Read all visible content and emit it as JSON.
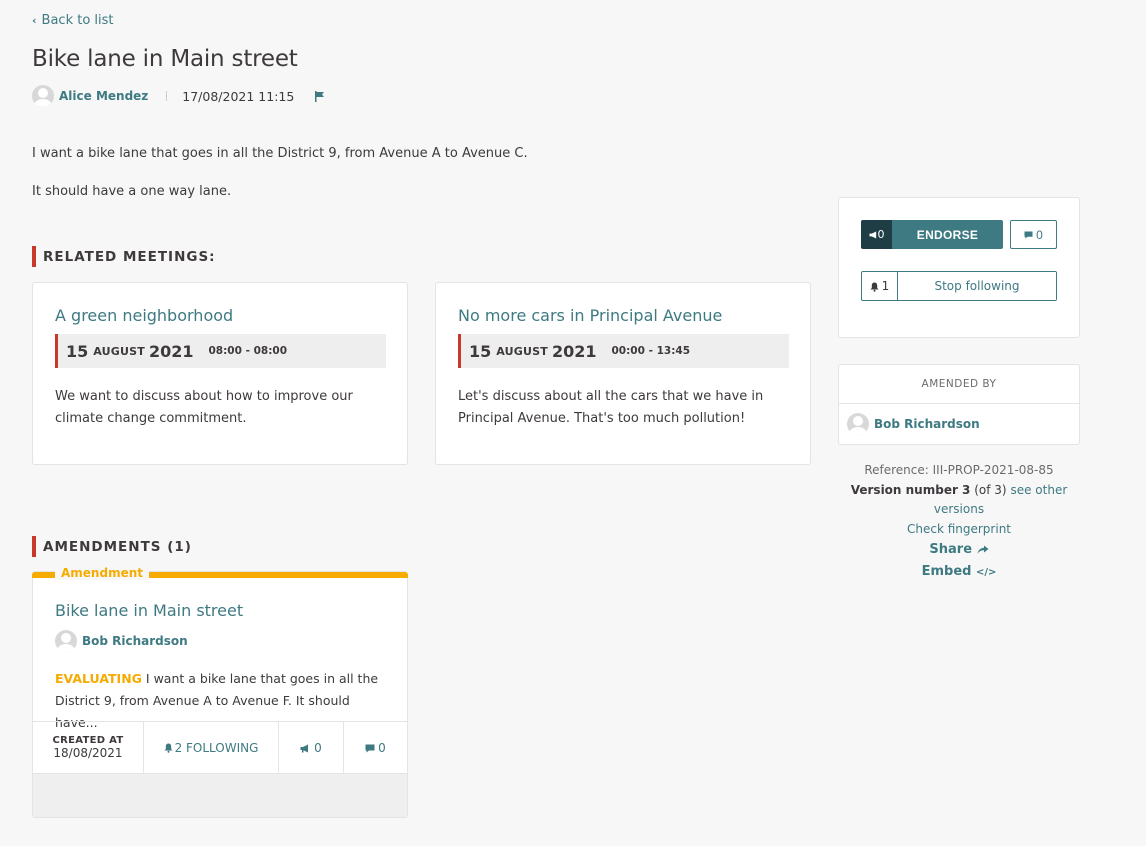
{
  "nav": {
    "back_label": "Back to list"
  },
  "proposal": {
    "title": "Bike lane in Main street",
    "author": "Alice Mendez",
    "date": "17/08/2021 11:15",
    "body": [
      "I want a bike lane that goes in all the District 9, from Avenue A to Avenue C.",
      "It should have a one way lane."
    ]
  },
  "related_meetings": {
    "heading": "RELATED MEETINGS:",
    "items": [
      {
        "title": "A green neighborhood",
        "day": "15",
        "month": "August",
        "year": "2021",
        "time": "08:00 - 08:00",
        "description": "We want to discuss about how to improve our climate change commitment."
      },
      {
        "title": "No more cars in Principal Avenue",
        "day": "15",
        "month": "August",
        "year": "2021",
        "time": "00:00 - 13:45",
        "description": "Let's discuss about all the cars that we have in Principal Avenue. That's too much pollution!"
      }
    ]
  },
  "amendments": {
    "heading": "AMENDMENTS (1)",
    "card": {
      "label": "Amendment",
      "title": "Bike lane in Main street",
      "author": "Bob Richardson",
      "status": "EVALUATING",
      "excerpt": "I want a bike lane that goes in all the District 9, from Avenue A to Avenue F. It should have...",
      "created_label": "CREATED AT",
      "created_value": "18/08/2021",
      "following": "2 FOLLOWING",
      "endorsements": "0",
      "comments": "0"
    }
  },
  "sidebar": {
    "endorse_count": "0",
    "endorse_label": "ENDORSE",
    "comments_count": "0",
    "followers_count": "1",
    "follow_label": "Stop following",
    "amended_by_heading": "AMENDED BY",
    "amended_by_author": "Bob Richardson",
    "reference": "Reference: III-PROP-2021-08-85",
    "version_label": "Version number 3",
    "version_of": "(of 3)",
    "see_versions": "see other versions",
    "fingerprint": "Check fingerprint",
    "share": "Share",
    "embed": "Embed"
  },
  "colors": {
    "primary": "#3e7a82",
    "primary_dark": "#1f3d44",
    "accent_red": "#c8392b",
    "warning": "#f5ab00",
    "background": "#f7f7f7"
  }
}
